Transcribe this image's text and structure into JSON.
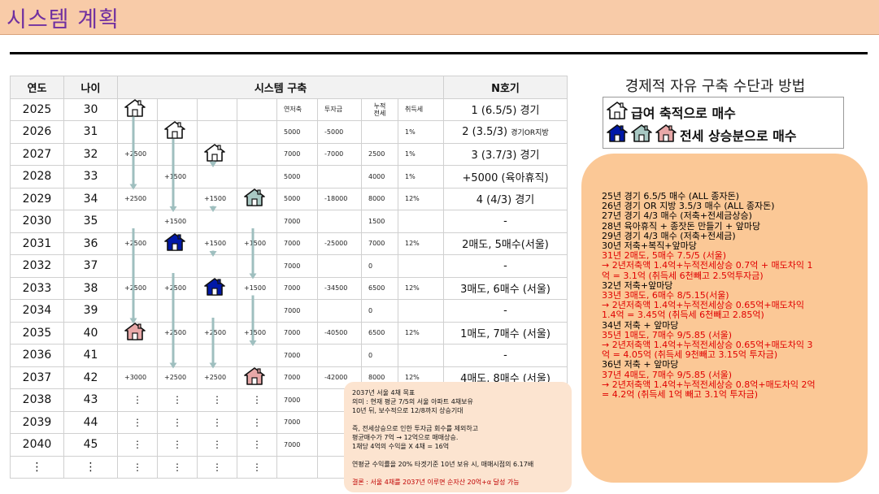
{
  "title": "시스템 계획",
  "table": {
    "headers": {
      "year": "연도",
      "age": "나이",
      "system": "시스템 구축",
      "n": "N호기"
    },
    "subheaders": {
      "savings": "연저축",
      "invest": "투자금",
      "jeonse_line1": "누적",
      "jeonse_line2": "전세",
      "tax": "취득세"
    },
    "rows": [
      {
        "year": "2025",
        "age": "30",
        "icons": [
          "white",
          "",
          "",
          ""
        ],
        "savings": "",
        "invest": "",
        "jeonse": "",
        "tax": "",
        "n": "1 (6.5/5) 경기",
        "n_small": ""
      },
      {
        "year": "2026",
        "age": "31",
        "icons": [
          "",
          "white",
          "",
          ""
        ],
        "savings": "5000",
        "invest": "-5000",
        "jeonse": "",
        "tax": "1%",
        "n": "2 (3.5/3) ",
        "n_small": "경기OR지방"
      },
      {
        "year": "2027",
        "age": "32",
        "icons": [
          "",
          "",
          "white",
          ""
        ],
        "vals": [
          "+2500",
          "",
          "",
          ""
        ],
        "savings": "7000",
        "invest": "-7000",
        "jeonse": "2500",
        "tax": "1%",
        "n": "3 (3.7/3) 경기",
        "n_small": ""
      },
      {
        "year": "2028",
        "age": "33",
        "icons": [
          "",
          "",
          "",
          ""
        ],
        "vals": [
          "",
          "+1500",
          "",
          ""
        ],
        "savings": "5000",
        "invest": "",
        "jeonse": "4000",
        "tax": "1%",
        "n": "+5000 (육아휴직)",
        "n_small": ""
      },
      {
        "year": "2029",
        "age": "34",
        "icons": [
          "",
          "",
          "",
          "gray"
        ],
        "vals": [
          "+2500",
          "",
          "+1500",
          ""
        ],
        "savings": "5000",
        "invest": "-18000",
        "jeonse": "8000",
        "tax": "12%",
        "n": "4 (4/3) 경기",
        "n_small": ""
      },
      {
        "year": "2030",
        "age": "35",
        "icons": [
          "",
          "",
          "",
          ""
        ],
        "vals": [
          "",
          "+1500",
          "",
          ""
        ],
        "savings": "7000",
        "invest": "",
        "jeonse": "1500",
        "tax": "",
        "n": "-",
        "n_small": ""
      },
      {
        "year": "2031",
        "age": "36",
        "icons": [
          "",
          "blue",
          "",
          ""
        ],
        "vals": [
          "+2500",
          "",
          "+1500",
          "+1500"
        ],
        "savings": "7000",
        "invest": "-25000",
        "jeonse": "7000",
        "tax": "12%",
        "n": "2매도, 5매수(서울)",
        "n_small": ""
      },
      {
        "year": "2032",
        "age": "37",
        "icons": [
          "",
          "",
          "",
          ""
        ],
        "vals": [
          "",
          "",
          "",
          ""
        ],
        "savings": "7000",
        "invest": "",
        "jeonse": "0",
        "tax": "",
        "n": "-",
        "n_small": ""
      },
      {
        "year": "2033",
        "age": "38",
        "icons": [
          "",
          "",
          "blue",
          ""
        ],
        "vals": [
          "+2500",
          "+2500",
          "",
          "+1500"
        ],
        "savings": "7000",
        "invest": "-34500",
        "jeonse": "6500",
        "tax": "12%",
        "n": "3매도, 6매수 (서울)",
        "n_small": ""
      },
      {
        "year": "2034",
        "age": "39",
        "icons": [
          "",
          "",
          "",
          ""
        ],
        "vals": [
          "",
          "",
          "",
          ""
        ],
        "savings": "7000",
        "invest": "",
        "jeonse": "0",
        "tax": "",
        "n": "-",
        "n_small": ""
      },
      {
        "year": "2035",
        "age": "40",
        "icons": [
          "pink",
          "",
          "",
          ""
        ],
        "vals": [
          "",
          "+2500",
          "+2500",
          "+1500"
        ],
        "savings": "7000",
        "invest": "-40500",
        "jeonse": "6500",
        "tax": "12%",
        "n": "1매도, 7매수 (서울)",
        "n_small": ""
      },
      {
        "year": "2036",
        "age": "41",
        "icons": [
          "",
          "",
          "",
          ""
        ],
        "vals": [
          "",
          "",
          "",
          ""
        ],
        "savings": "7000",
        "invest": "",
        "jeonse": "0",
        "tax": "",
        "n": "-",
        "n_small": ""
      },
      {
        "year": "2037",
        "age": "42",
        "icons": [
          "",
          "",
          "",
          "pink"
        ],
        "vals": [
          "+3000",
          "+2500",
          "+2500",
          ""
        ],
        "savings": "7000",
        "invest": "-42000",
        "jeonse": "8000",
        "tax": "12%",
        "n": "4매도, 8매수 (서울)",
        "n_small": ""
      },
      {
        "year": "2038",
        "age": "43",
        "dots": true,
        "savings": "7000"
      },
      {
        "year": "2039",
        "age": "44",
        "dots": true,
        "savings": "7000"
      },
      {
        "year": "2040",
        "age": "45",
        "dots": true,
        "savings": "7000"
      },
      {
        "year": "⋮",
        "age": "⋮",
        "dots": true,
        "savings": ""
      }
    ]
  },
  "goal_box": {
    "lines": [
      "2037년 서울 4채 목표",
      "의미 : 현재 평균 7/5의 서울 아파트 4채보유",
      "10년 뒤, 보수적으로 12/8까지 상승기대",
      "",
      "즉, 전세상승으로 인한 투자금 회수를 제외하고",
      "평균매수가 7억 → 12억으로 매매상승.",
      "1채당 4억의 수익을 X 4채 = 16억",
      "",
      "연평균 수익률을 20% 타겟기준 10년 보유 시, 매매시점의 6.17배",
      ""
    ],
    "conclusion": "결론 : 서울 4채를 2037년 이루면 순자산 20억+α 달성 가능"
  },
  "right_title": "경제적 자유 구축 수단과 방법",
  "legend": {
    "row1": "급여 축적으로 매수",
    "row2": "전세 상승분으로 매수"
  },
  "colors": {
    "title_bg": "#f8cba8",
    "title_text": "#7030a0",
    "box_bg": "#fbc896",
    "goal_bg": "#fce4d0",
    "red": "#e00000",
    "blue": "#0018a8",
    "gray": "#a9c9c4",
    "pink": "#e8a8a8",
    "arrow": "#9fbfbf"
  },
  "plan_lines": [
    {
      "text": "25년 경기 6.5/5 매수 (ALL 종자돈)",
      "red": false
    },
    {
      "text": "26년 경기 OR 지방 3.5/3 매수 (ALL 종자돈)",
      "red": false
    },
    {
      "text": "27년 경기 4/3 매수 (저축+전세금상승)",
      "red": false
    },
    {
      "text": "28년 육아휴직 + 종잣돈 만들기 + 앞마당",
      "red": false
    },
    {
      "text": "29년 경기 4/3 매수 (저축+전세금)",
      "red": false
    },
    {
      "text": "30년 저축+복직+앞마당",
      "red": false
    },
    {
      "text": "31년 2매도, 5매수 7.5/5 (서울)",
      "red": true
    },
    {
      "text": "→ 2년저축액 1.4억+누적전세상승 0.7억 + 매도차익 1",
      "red": true
    },
    {
      "text": "억 = 3.1억 (취득세 6천빼고 2.5억투자금)",
      "red": true
    },
    {
      "text": "32년 저축+앞마당",
      "red": false
    },
    {
      "text": "33년 3매도, 6매수 8/5.15(서울)",
      "red": true
    },
    {
      "text": "→ 2년저축액 1.4억+누적전세상승 0.65억+매도차익",
      "red": true
    },
    {
      "text": "1.4억 = 3.45억 (취득세 6천빼고 2.85억)",
      "red": true
    },
    {
      "text": "34년 저축 + 앞마당",
      "red": false
    },
    {
      "text": "35년 1매도, 7매수 9/5.85 (서울)",
      "red": true
    },
    {
      "text": "→ 2년저축액 1.4억+누적전세상승 0.65억+매도차익 3",
      "red": true
    },
    {
      "text": "억 = 4.05억 (취득세 9천빼고 3.15억 투자금)",
      "red": true
    },
    {
      "text": "36년 저축 + 앞마당",
      "red": false
    },
    {
      "text": "37년 4매도, 7매수 9/5.85 (서울)",
      "red": true
    },
    {
      "text": "→ 2년저축액 1.4억+누적전세상승 0.8억+매도차익 2억",
      "red": true
    },
    {
      "text": "= 4.2억 (취득세 1억 빼고 3.1억 투자금)",
      "red": true
    }
  ]
}
